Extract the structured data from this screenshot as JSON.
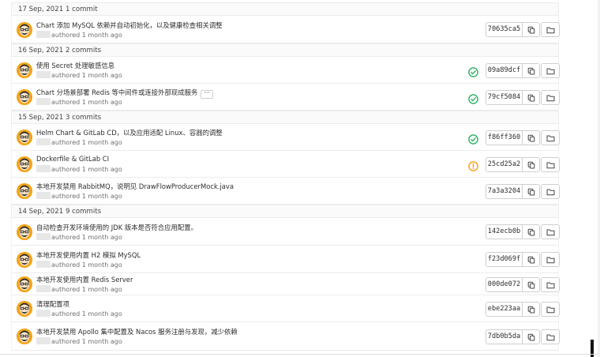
{
  "groups": [
    {
      "date": "17 Sep, 2021",
      "count": "1 commit",
      "commits": [
        {
          "title": "Chart 添加 MySQL 依赖并自动初始化，以及健康检查相关调整",
          "authored": "authored 1 month ago",
          "status": "",
          "sha": "70635ca5",
          "more": false
        }
      ]
    },
    {
      "date": "16 Sep, 2021",
      "count": "2 commits",
      "commits": [
        {
          "title": "使用 Secret 处理敏感信息",
          "authored": "authored 1 month ago",
          "status": "success",
          "sha": "09a89dcf",
          "more": false
        },
        {
          "title": "Chart 分场景部署 Redis 等中间件或连接外部现成服务",
          "authored": "authored 1 month ago",
          "status": "success",
          "sha": "79cf5084",
          "more": true
        }
      ]
    },
    {
      "date": "15 Sep, 2021",
      "count": "3 commits",
      "commits": [
        {
          "title": "Helm Chart & GitLab CD，以及应用适配 Linux、容器的调整",
          "authored": "authored 1 month ago",
          "status": "success",
          "sha": "f86ff360",
          "more": false
        },
        {
          "title": "Dockerfile & GitLab CI",
          "authored": "authored 1 month ago",
          "status": "warning",
          "sha": "25cd25a2",
          "more": false
        },
        {
          "title": "本地开发禁用 RabbitMQ，说明见 DrawFlowProducerMock.java",
          "authored": "authored 1 month ago",
          "status": "",
          "sha": "7a3a3204",
          "more": false
        }
      ]
    },
    {
      "date": "14 Sep, 2021",
      "count": "9 commits",
      "commits": [
        {
          "title": "自动检查开发环境使用的 JDK 版本是否符合应用配置。",
          "authored": "authored 1 month ago",
          "status": "",
          "sha": "142ecb0b",
          "more": false
        },
        {
          "title": "本地开发使用内置 H2 模拟 MySQL",
          "authored": "authored 1 month ago",
          "status": "",
          "sha": "f23d069f",
          "more": false
        },
        {
          "title": "本地开发使用内置 Redis Server",
          "authored": "authored 1 month ago",
          "status": "",
          "sha": "000de072",
          "more": false
        },
        {
          "title": "清理配置项",
          "authored": "authored 1 month ago",
          "status": "",
          "sha": "ebe223aa",
          "more": false
        },
        {
          "title": "本地开发禁用 Apollo 集中配置及 Nacos 服务注册与发现，减少依赖",
          "authored": "authored 1 month ago",
          "status": "",
          "sha": "7db0b5da",
          "more": false
        }
      ]
    }
  ],
  "icons": {
    "copy": "copy-icon",
    "browse": "folder-icon",
    "avatar": "avatar-icon",
    "success": "check-circle-icon",
    "warning": "exclamation-circle-icon",
    "more": "ellipsis-icon"
  },
  "colors": {
    "success": "#1aaa55",
    "warning": "#fc9403",
    "avatar": "#f3a51a",
    "border": "#cfcfcf"
  }
}
